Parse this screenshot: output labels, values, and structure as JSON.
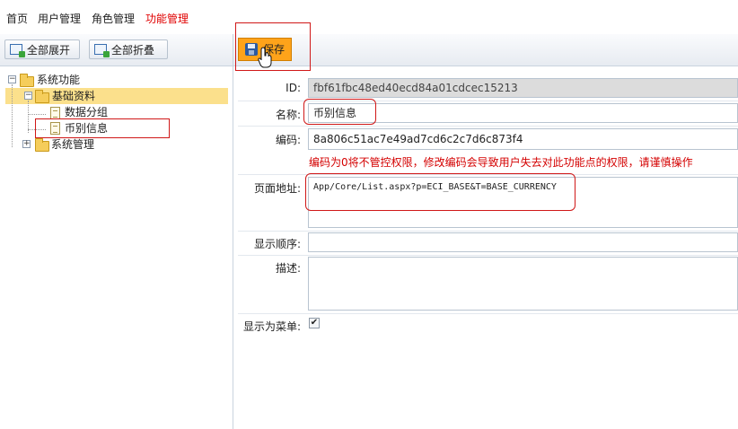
{
  "topnav": {
    "items": [
      "首页",
      "用户管理",
      "角色管理",
      "功能管理"
    ],
    "active": "功能管理",
    "active_color": "#e00000"
  },
  "left_toolbar": {
    "expand_all": "全部展开",
    "collapse_all": "全部折叠"
  },
  "tree": {
    "root": "系统功能",
    "basic": "基础资料",
    "data_group": "数据分组",
    "currency": "币别信息",
    "system": "系统管理",
    "selected_color": "#fbe08c"
  },
  "right_toolbar": {
    "save": "保存",
    "save_color": "#fea31a"
  },
  "form": {
    "id_label": "ID:",
    "id_value": "fbf61fbc48ed40ecd84a01cdcec15213",
    "name_label": "名称:",
    "name_value": "币别信息",
    "code_label": "编码:",
    "code_value": "8a806c51ac7e49ad7cd6c2c7d6c873f4",
    "code_warning": "编码为0将不管控权限，修改编码会导致用户失去对此功能点的权限，请谨慎操作",
    "warning_color": "#d40000",
    "url_label": "页面地址:",
    "url_value": "App/Core/List.aspx?p=ECI_BASE&T=BASE_CURRENCY",
    "order_label": "显示顺序:",
    "order_value": "",
    "desc_label": "描述:",
    "desc_value": "",
    "menu_label": "显示为菜单:",
    "menu_checked": "✔"
  },
  "icons": {
    "save": "save-disk-icon",
    "expand": "expand-tree-icon",
    "collapse": "collapse-tree-icon",
    "folder": "folder-icon",
    "document": "document-icon",
    "cursor": "hand-cursor-icon"
  },
  "annotation_color": "#d01818"
}
